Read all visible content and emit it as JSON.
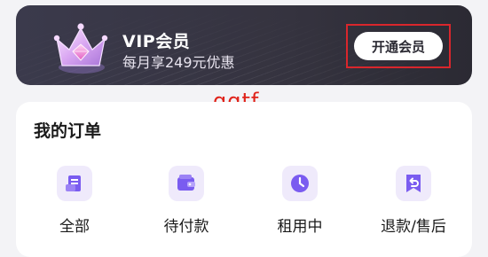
{
  "vip": {
    "title": "VIP会员",
    "subtitle": "每月享249元优惠",
    "open_button": "开通会员"
  },
  "watermark": "qqtf",
  "orders": {
    "title": "我的订单",
    "items": [
      {
        "label": "全部",
        "icon": "document-icon"
      },
      {
        "label": "待付款",
        "icon": "wallet-icon"
      },
      {
        "label": "租用中",
        "icon": "clock-icon"
      },
      {
        "label": "退款/售后",
        "icon": "refund-icon"
      }
    ]
  },
  "colors": {
    "accent": "#7a5cf0",
    "icon_bg": "#efeafb",
    "banner_bg": "#3b3a4c",
    "highlight_border": "#d9262c",
    "watermark": "#e0231a"
  }
}
